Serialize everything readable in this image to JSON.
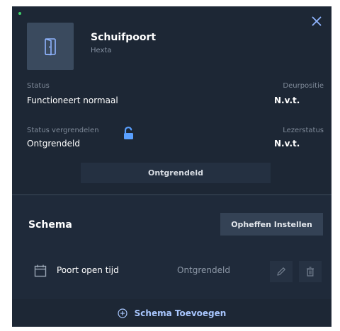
{
  "device": {
    "name": "Schuifpoort",
    "brand": "Hexta",
    "icon": "door-icon"
  },
  "info": {
    "status_label": "Status",
    "status_value": "Functioneert normaal",
    "door_position_label": "Deurpositie",
    "door_position_value": "N.v.t.",
    "lock_status_label": "Status vergrendelen",
    "lock_status_value": "Ontgrendeld",
    "reader_status_label": "Lezerstatus",
    "reader_status_value": "N.v.t."
  },
  "state_bar": {
    "label": "Ontgrendeld"
  },
  "schedule": {
    "title": "Schema",
    "override_button": "Opheffen Instellen",
    "items": [
      {
        "name": "Poort open tijd",
        "state": "Ontgrendeld"
      }
    ],
    "add_label": "Schema Toevoegen"
  },
  "colors": {
    "panel_bg": "#1d2735",
    "accent_blue": "#5aa0ff",
    "status_green": "#3fd36b"
  }
}
